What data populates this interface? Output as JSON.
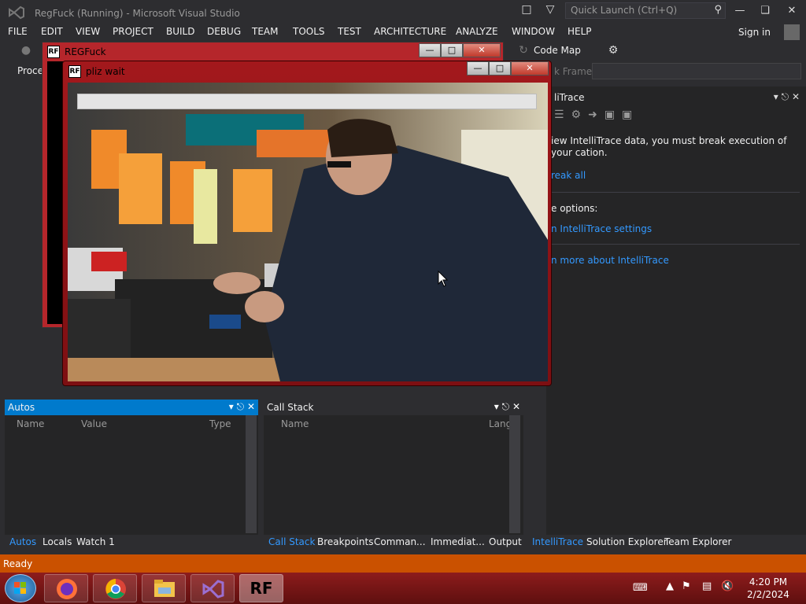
{
  "titlebar": {
    "title": "RegFuck (Running) - Microsoft Visual Studio",
    "quick_launch_placeholder": "Quick Launch (Ctrl+Q)"
  },
  "menu": [
    "FILE",
    "EDIT",
    "VIEW",
    "PROJECT",
    "BUILD",
    "DEBUG",
    "TEAM",
    "TOOLS",
    "TEST",
    "ARCHITECTURE",
    "ANALYZE",
    "WINDOW",
    "HELP"
  ],
  "signin": "Sign in",
  "toolbar": {
    "codemap": "Code Map"
  },
  "process_label": "Proce",
  "stackframe_label": "k Frame:",
  "intellitrace": {
    "title": "liTrace",
    "text": "iew IntelliTrace data, you must break execution of your cation.",
    "break_all": "reak all",
    "options_label": "e options:",
    "settings_link": "n IntelliTrace settings",
    "learn_link": "n more about IntelliTrace"
  },
  "autos": {
    "title": "Autos",
    "columns": [
      "Name",
      "Value",
      "Type"
    ]
  },
  "callstack": {
    "title": "Call Stack",
    "columns": [
      "Name",
      "Lang"
    ]
  },
  "tabs_left": [
    "Autos",
    "Locals",
    "Watch 1"
  ],
  "tabs_mid": [
    "Call Stack",
    "Breakpoints",
    "Comman...",
    "Immediat...",
    "Output"
  ],
  "tabs_right": [
    "IntelliTrace",
    "Solution Explorer",
    "Team Explorer"
  ],
  "status": "Ready",
  "regwin": {
    "title": "REGFuck",
    "icon_text": "RF"
  },
  "plizwin": {
    "title": "pliz wait",
    "icon_text": "RF"
  },
  "taskbar": {
    "rf_app": "RF"
  },
  "clock": {
    "time": "4:20 PM",
    "date": "2/2/2024"
  },
  "colors": {
    "vs_bg": "#2d2d30",
    "status_orange": "#ca5100",
    "accent_blue": "#007acc",
    "link_blue": "#3399ff",
    "taskbar_red": "#8d1c1c"
  }
}
